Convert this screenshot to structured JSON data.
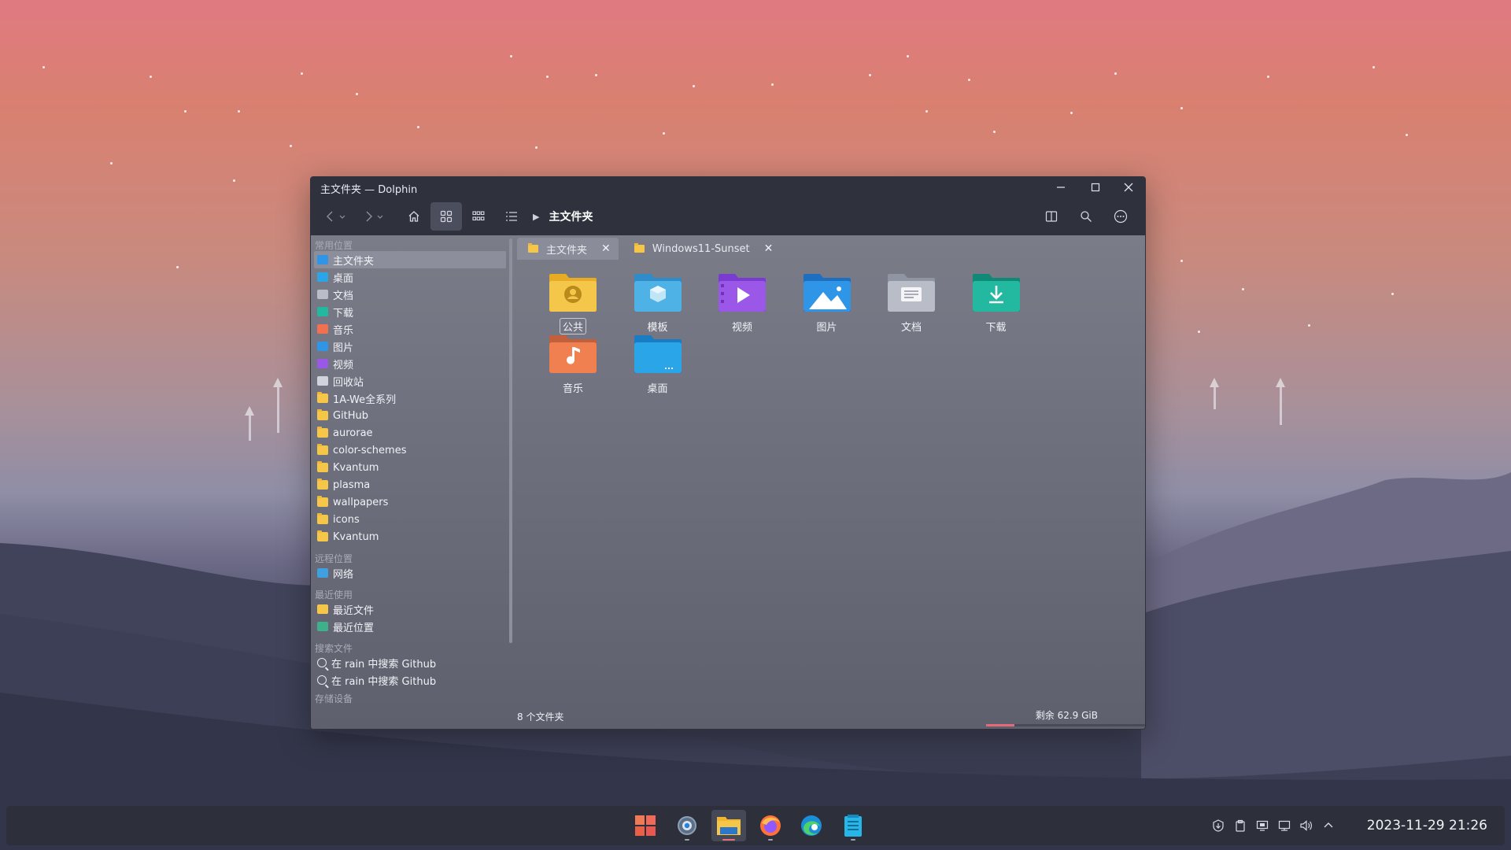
{
  "window": {
    "title": "主文件夹 — Dolphin",
    "breadcrumb": "主文件夹"
  },
  "sidebar": {
    "sections": {
      "places": "常用位置",
      "remote": "远程位置",
      "recent": "最近使用",
      "search": "搜索文件",
      "devices": "存储设备"
    },
    "places": [
      {
        "label": "主文件夹",
        "icon": "home-icon"
      },
      {
        "label": "桌面",
        "icon": "desktop-icon"
      },
      {
        "label": "文档",
        "icon": "documents-icon"
      },
      {
        "label": "下载",
        "icon": "downloads-icon"
      },
      {
        "label": "音乐",
        "icon": "music-icon"
      },
      {
        "label": "图片",
        "icon": "pictures-icon"
      },
      {
        "label": "视频",
        "icon": "videos-icon"
      },
      {
        "label": "回收站",
        "icon": "trash-icon"
      },
      {
        "label": "1A-We全系列",
        "icon": "folder-icon"
      },
      {
        "label": "GitHub",
        "icon": "folder-icon"
      },
      {
        "label": "aurorae",
        "icon": "folder-icon"
      },
      {
        "label": "color-schemes",
        "icon": "folder-icon"
      },
      {
        "label": "Kvantum",
        "icon": "folder-icon"
      },
      {
        "label": "plasma",
        "icon": "folder-icon"
      },
      {
        "label": "wallpapers",
        "icon": "folder-icon"
      },
      {
        "label": "icons",
        "icon": "folder-icon"
      },
      {
        "label": "Kvantum",
        "icon": "folder-icon"
      }
    ],
    "remote": [
      {
        "label": "网络",
        "icon": "network-icon"
      }
    ],
    "recent": [
      {
        "label": "最近文件",
        "icon": "recent-files-icon"
      },
      {
        "label": "最近位置",
        "icon": "recent-locations-icon"
      }
    ],
    "search": [
      {
        "label": "在 rain 中搜索 Github"
      },
      {
        "label": "在 rain 中搜索 Github"
      }
    ]
  },
  "tabs": [
    {
      "label": "主文件夹",
      "active": true
    },
    {
      "label": "Windows11-Sunset",
      "active": false
    }
  ],
  "files": [
    {
      "label": "公共",
      "icon": "public-folder-icon",
      "color": "#f4c64a"
    },
    {
      "label": "模板",
      "icon": "templates-folder-icon",
      "color": "#4fb2e6"
    },
    {
      "label": "视频",
      "icon": "videos-folder-icon",
      "color": "#9b57e8"
    },
    {
      "label": "图片",
      "icon": "pictures-folder-icon",
      "color": "#2f95e6"
    },
    {
      "label": "文档",
      "icon": "documents-folder-icon",
      "color": "#b8bdc8"
    },
    {
      "label": "下载",
      "icon": "downloads-folder-icon",
      "color": "#23b8a0"
    },
    {
      "label": "音乐",
      "icon": "music-folder-icon",
      "color": "#f08050"
    },
    {
      "label": "桌面",
      "icon": "desktop-folder-icon",
      "color": "#2aa6e8"
    }
  ],
  "status": {
    "summary": "8 个文件夹",
    "free_space": "剩余 62.9 GiB",
    "used_fraction": 0.18
  },
  "taskbar": {
    "apps": [
      "start-icon",
      "settings-icon",
      "file-manager-icon",
      "firefox-icon",
      "edge-icon",
      "notes-icon"
    ],
    "clock": "2023-11-29 21:26"
  },
  "colors": {
    "accent": "#e8707c",
    "window_bg": "#2f323d"
  }
}
